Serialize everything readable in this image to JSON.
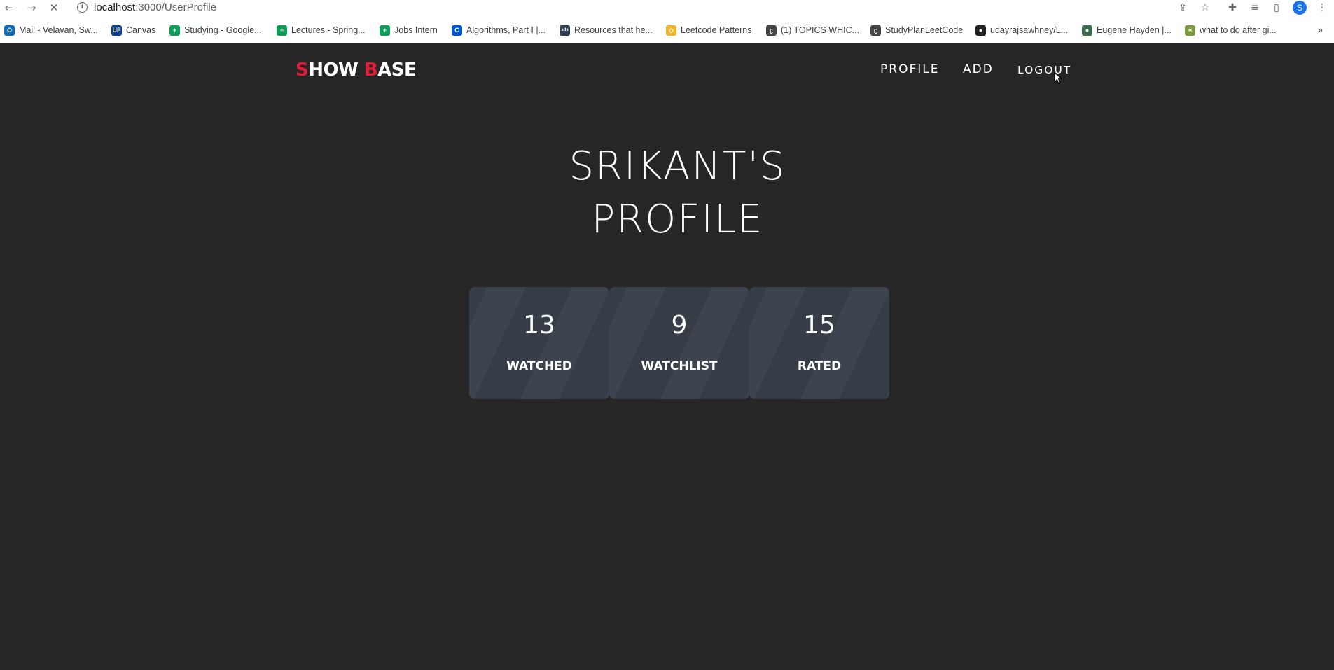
{
  "browser": {
    "url_host": "localhost",
    "url_path": ":3000/UserProfile",
    "avatar_letter": "S",
    "bookmarks": [
      {
        "label": "Mail - Velavan, Sw...",
        "icon": "outlook-icon",
        "color": "#0f6cbd",
        "glyph": "O"
      },
      {
        "label": "Canvas",
        "icon": "uf-icon",
        "color": "#0b3f91",
        "glyph": "UF"
      },
      {
        "label": "Studying - Google...",
        "icon": "sheets-icon",
        "color": "#0f9d58",
        "glyph": "+"
      },
      {
        "label": "Lectures - Spring...",
        "icon": "sheets-icon",
        "color": "#0f9d58",
        "glyph": "+"
      },
      {
        "label": "Jobs Intern",
        "icon": "sheets-icon",
        "color": "#0f9d58",
        "glyph": "+"
      },
      {
        "label": "Algorithms, Part I |...",
        "icon": "coursera-icon",
        "color": "#0056d2",
        "glyph": "C"
      },
      {
        "label": "Resources that he...",
        "icon": "sds-icon",
        "color": "#2c3e50",
        "glyph": "sds"
      },
      {
        "label": "Leetcode Patterns",
        "icon": "leetcode-patterns-icon",
        "color": "#f0b429",
        "glyph": "◇"
      },
      {
        "label": "(1) TOPICS WHIC...",
        "icon": "leetcode-icon",
        "color": "#444444",
        "glyph": "ʗ"
      },
      {
        "label": "StudyPlanLeetCode",
        "icon": "leetcode-icon",
        "color": "#444444",
        "glyph": "ʗ"
      },
      {
        "label": "udayrajsawhney/L...",
        "icon": "github-icon",
        "color": "#222222",
        "glyph": "●"
      },
      {
        "label": "Eugene Hayden |...",
        "icon": "avatar-icon",
        "color": "#3b6e4f",
        "glyph": "●"
      },
      {
        "label": "what to do after gi...",
        "icon": "sparkle-icon",
        "color": "#7b9b3a",
        "glyph": "✶"
      }
    ]
  },
  "site": {
    "logo_s": "S",
    "logo_how": "HOW ",
    "logo_b": "B",
    "logo_ase": "ASE",
    "nav": {
      "profile": "PROFILE",
      "add": "ADD",
      "logout": "LOGOUT"
    },
    "title_line1": "SRIKANT'S",
    "title_line2": "PROFILE",
    "stats": [
      {
        "value": "13",
        "label": "WATCHED"
      },
      {
        "value": "9",
        "label": "WATCHLIST"
      },
      {
        "value": "15",
        "label": "RATED"
      }
    ]
  },
  "colors": {
    "background": "#272626",
    "accent": "#e01e3c",
    "card": "#363d47"
  }
}
